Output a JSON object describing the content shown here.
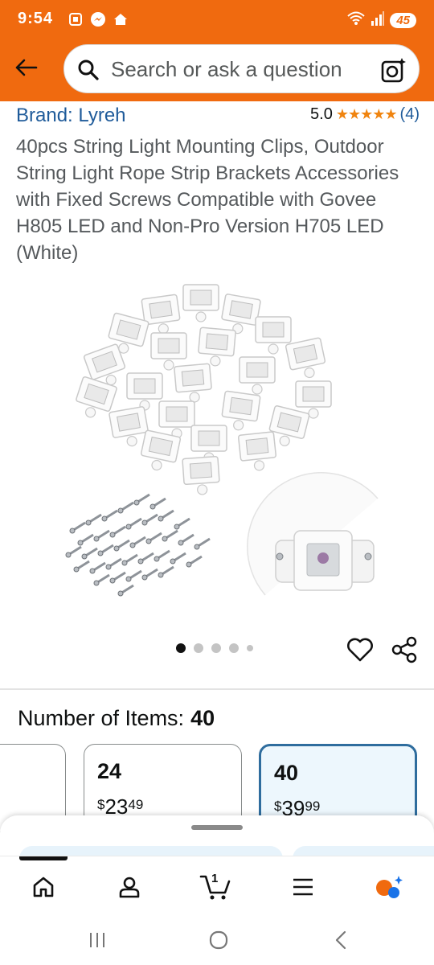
{
  "status_bar": {
    "time": "9:54",
    "battery": "45"
  },
  "search": {
    "placeholder": "Search or ask a question"
  },
  "product": {
    "brand": "Brand: Lyreh",
    "rating_value": "5.0",
    "stars": "★★★★★",
    "rating_count": "(4)",
    "title": "40pcs String Light Mounting Clips, Outdoor String Light Rope Strip Brackets Accessories with Fixed Screws Compatible with Govee H805 LED and Non-Pro Version H705 LED (White)"
  },
  "gallery": {
    "image_count": 5,
    "active_index": 0
  },
  "variation": {
    "label": "Number of Items:",
    "selected": "40",
    "options": [
      {
        "qty": "",
        "symbol": "",
        "whole": "",
        "cents": ""
      },
      {
        "qty": "24",
        "symbol": "$",
        "whole": "23",
        "cents": "49"
      },
      {
        "qty": "40",
        "symbol": "$",
        "whole": "39",
        "cents": "99"
      }
    ]
  },
  "bottom_nav": {
    "cart_count": "1",
    "items": [
      "home-icon",
      "account-icon",
      "cart-icon",
      "menu-icon",
      "rufus-icon"
    ]
  },
  "colors": {
    "header": "#f06a0f",
    "link": "#1f5b9a",
    "star": "#f0840f",
    "selected_border": "#2f6d9e",
    "selected_bg": "#edf7fd"
  }
}
